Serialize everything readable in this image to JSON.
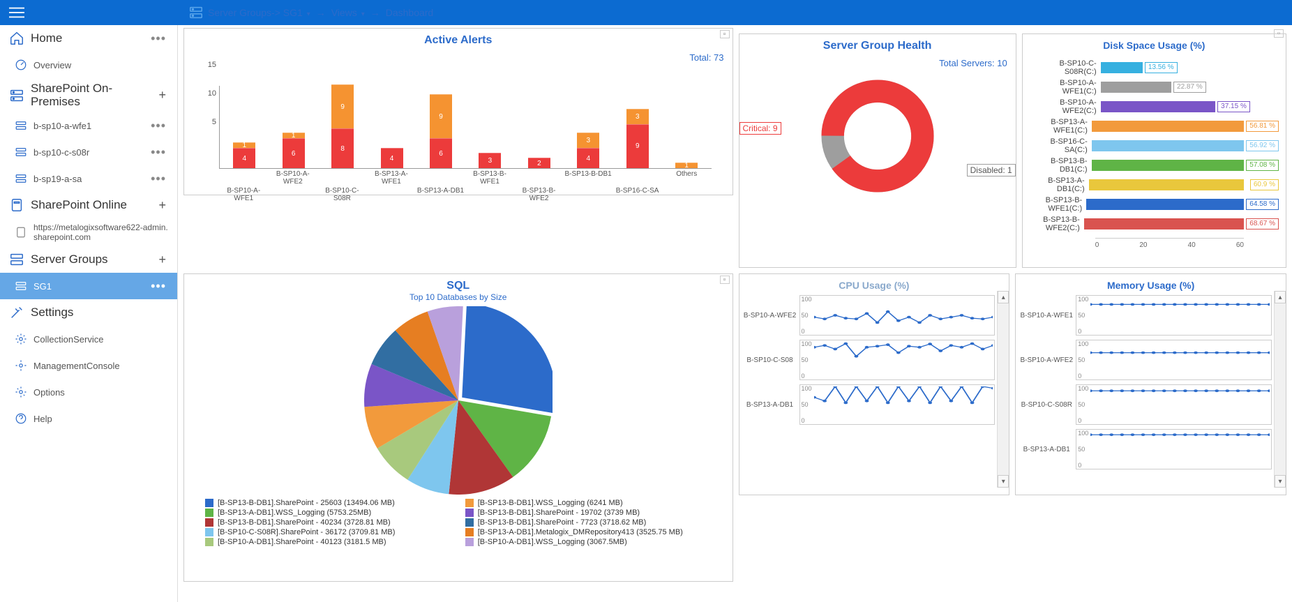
{
  "breadcrumb": {
    "group": "Server Groups-> SG1",
    "views": "Views",
    "dashboard": "Dashboard"
  },
  "sidebar": {
    "home": "Home",
    "overview": "Overview",
    "sp_onprem": "SharePoint On-Premises",
    "onprem_servers": [
      "b-sp10-a-wfe1",
      "b-sp10-c-s08r",
      "b-sp19-a-sa"
    ],
    "sp_online": "SharePoint Online",
    "online_site": "https://metalogixsoftware622-admin.sharepoint.com",
    "server_groups": "Server Groups",
    "sg1": "SG1",
    "settings": "Settings",
    "collection": "CollectionService",
    "mgmt": "ManagementConsole",
    "options": "Options",
    "help": "Help"
  },
  "alerts": {
    "title": "Active Alerts",
    "total_label": "Total: 73",
    "yticks": [
      "15",
      "10",
      "5"
    ],
    "top_labels": [
      "B-SP10-A-WFE2",
      "B-SP13-A-WFE1",
      "B-SP13-B-WFE1",
      "B-SP13-B-DB1"
    ],
    "bottom_labels": [
      "B-SP10-A-WFE1",
      "B-SP10-C-S08R",
      "B-SP13-A-DB1",
      "B-SP13-B-WFE2",
      "B-SP16-C-SA",
      "Others"
    ]
  },
  "health": {
    "title": "Server Group Health",
    "total": "Total Servers: 10",
    "critical": "Critical: 9",
    "disabled": "Disabled: 1"
  },
  "disk": {
    "title": "Disk Space Usage (%)",
    "rows": [
      {
        "lbl": "B-SP10-C-S08R(C:)",
        "pct": 13.56,
        "color": "#36b0e0"
      },
      {
        "lbl": "B-SP10-A-WFE1(C:)",
        "pct": 22.87,
        "color": "#9e9e9e"
      },
      {
        "lbl": "B-SP10-A-WFE2(C:)",
        "pct": 37.15,
        "color": "#7a55c7"
      },
      {
        "lbl": "B-SP13-A-WFE1(C:)",
        "pct": 56.81,
        "color": "#f29a3c"
      },
      {
        "lbl": "B-SP16-C-SA(C:)",
        "pct": 56.92,
        "color": "#7ec6ee"
      },
      {
        "lbl": "B-SP13-B-DB1(C:)",
        "pct": 57.08,
        "color": "#5fb446"
      },
      {
        "lbl": "B-SP13-A-DB1(C:)",
        "pct": 60.9,
        "color": "#e9c73c"
      },
      {
        "lbl": "B-SP13-B-WFE1(C:)",
        "pct": 64.58,
        "color": "#2c6bca"
      },
      {
        "lbl": "B-SP13-B-WFE2(C:)",
        "pct": 68.67,
        "color": "#d9534f"
      }
    ],
    "xticks": [
      "0",
      "20",
      "40",
      "60"
    ]
  },
  "sql": {
    "title": "SQL",
    "subtitle": "Top 10 Databases by Size",
    "legend": [
      {
        "c": "#2c6bca",
        "t": "[B-SP13-B-DB1].SharePoint - 25603 (13494.06 MB)"
      },
      {
        "c": "#5fb446",
        "t": "[B-SP13-A-DB1].WSS_Logging (5753.25MB)"
      },
      {
        "c": "#b03636",
        "t": "[B-SP13-B-DB1].SharePoint - 40234 (3728.81 MB)"
      },
      {
        "c": "#7ec6ee",
        "t": "[B-SP10-C-S08R].SharePoint - 36172 (3709.81 MB)"
      },
      {
        "c": "#a8c97d",
        "t": "[B-SP10-A-DB1].SharePoint - 40123 (3181.5 MB)"
      },
      {
        "c": "#f29a3c",
        "t": "[B-SP13-B-DB1].WSS_Logging (6241 MB)"
      },
      {
        "c": "#7a55c7",
        "t": "[B-SP13-B-DB1].SharePoint - 19702 (3739 MB)"
      },
      {
        "c": "#316ea2",
        "t": "[B-SP13-B-DB1].SharePoint - 7723 (3718.62 MB)"
      },
      {
        "c": "#e67e22",
        "t": "[B-SP13-A-DB1].Metalogix_DMRepository413 (3525.75 MB)"
      },
      {
        "c": "#b9a0dc",
        "t": "[B-SP10-A-DB1].WSS_Logging (3067.5MB)"
      }
    ]
  },
  "cpu": {
    "title": "CPU Usage (%)",
    "servers": [
      "B-SP10-A-WFE2",
      "B-SP10-C-S08",
      "B-SP13-A-DB1"
    ]
  },
  "mem": {
    "title": "Memory Usage (%)",
    "servers": [
      "B-SP10-A-WFE1",
      "B-SP10-A-WFE2",
      "B-SP10-C-S08R",
      "B-SP13-A-DB1"
    ]
  },
  "chart_data": {
    "active_alerts": {
      "type": "bar",
      "stacked": true,
      "categories": [
        "B-SP10-A-WFE1",
        "B-SP10-A-WFE2",
        "B-SP10-C-S08R",
        "B-SP13-A-WFE1",
        "B-SP13-A-DB1",
        "B-SP13-B-WFE1",
        "B-SP13-B-WFE2",
        "B-SP13-B-DB1",
        "B-SP16-C-SA",
        "Others"
      ],
      "series": [
        {
          "name": "red",
          "values": [
            4,
            6,
            8,
            4,
            6,
            3,
            2,
            4,
            9,
            0
          ]
        },
        {
          "name": "orange",
          "values": [
            1,
            1,
            9,
            0,
            9,
            0,
            0,
            3,
            3,
            1
          ]
        }
      ],
      "ylim": [
        0,
        17
      ],
      "total": 73
    },
    "server_group_health": {
      "type": "pie",
      "slices": [
        {
          "label": "Critical",
          "value": 9,
          "color": "#ec3b3b"
        },
        {
          "label": "Disabled",
          "value": 1,
          "color": "#9e9e9e"
        }
      ],
      "total": 10
    },
    "disk_space": {
      "type": "bar",
      "orientation": "horizontal",
      "categories": [
        "B-SP10-C-S08R(C:)",
        "B-SP10-A-WFE1(C:)",
        "B-SP10-A-WFE2(C:)",
        "B-SP13-A-WFE1(C:)",
        "B-SP16-C-SA(C:)",
        "B-SP13-B-DB1(C:)",
        "B-SP13-A-DB1(C:)",
        "B-SP13-B-WFE1(C:)",
        "B-SP13-B-WFE2(C:)"
      ],
      "values": [
        13.56,
        22.87,
        37.15,
        56.81,
        56.92,
        57.08,
        60.9,
        64.58,
        68.67
      ],
      "xlim": [
        0,
        70
      ]
    },
    "sql_top10": {
      "type": "pie",
      "slices": [
        {
          "label": "[B-SP13-B-DB1].SharePoint - 25603",
          "value": 13494.06
        },
        {
          "label": "[B-SP13-B-DB1].WSS_Logging",
          "value": 6241
        },
        {
          "label": "[B-SP13-A-DB1].WSS_Logging",
          "value": 5753.25
        },
        {
          "label": "[B-SP13-B-DB1].SharePoint - 19702",
          "value": 3739
        },
        {
          "label": "[B-SP13-B-DB1].SharePoint - 40234",
          "value": 3728.81
        },
        {
          "label": "[B-SP13-B-DB1].SharePoint - 7723",
          "value": 3718.62
        },
        {
          "label": "[B-SP10-C-S08R].SharePoint - 36172",
          "value": 3709.81
        },
        {
          "label": "[B-SP13-A-DB1].Metalogix_DMRepository413",
          "value": 3525.75
        },
        {
          "label": "[B-SP10-A-DB1].SharePoint - 40123",
          "value": 3181.5
        },
        {
          "label": "[B-SP10-A-DB1].WSS_Logging",
          "value": 3067.5
        }
      ]
    },
    "cpu_usage": {
      "type": "line",
      "ylim": [
        0,
        100
      ],
      "series": [
        {
          "name": "B-SP10-A-WFE2",
          "values": [
            45,
            40,
            50,
            42,
            40,
            55,
            30,
            60,
            35,
            45,
            30,
            50,
            40,
            45,
            50,
            42,
            40,
            45
          ]
        },
        {
          "name": "B-SP10-C-S08",
          "values": [
            85,
            90,
            80,
            95,
            60,
            85,
            88,
            92,
            70,
            88,
            85,
            94,
            75,
            90,
            85,
            95,
            80,
            90
          ]
        },
        {
          "name": "B-SP13-A-DB1",
          "values": [
            70,
            60,
            100,
            55,
            100,
            60,
            100,
            55,
            100,
            60,
            100,
            55,
            100,
            60,
            100,
            55,
            100,
            95
          ]
        }
      ]
    },
    "memory_usage": {
      "type": "line",
      "ylim": [
        0,
        100
      ],
      "series": [
        {
          "name": "B-SP10-A-WFE1",
          "values": [
            80,
            80,
            80,
            80,
            80,
            80,
            80,
            80,
            80,
            80,
            80,
            80,
            80,
            80,
            80,
            80,
            80,
            80
          ]
        },
        {
          "name": "B-SP10-A-WFE2",
          "values": [
            70,
            70,
            70,
            70,
            70,
            70,
            70,
            70,
            70,
            70,
            70,
            70,
            70,
            70,
            70,
            70,
            70,
            70
          ]
        },
        {
          "name": "B-SP10-C-S08R",
          "values": [
            88,
            88,
            88,
            88,
            88,
            88,
            88,
            88,
            88,
            88,
            88,
            88,
            88,
            88,
            88,
            88,
            88,
            88
          ]
        },
        {
          "name": "B-SP13-A-DB1",
          "values": [
            90,
            90,
            90,
            90,
            90,
            90,
            90,
            90,
            90,
            90,
            90,
            90,
            90,
            90,
            90,
            90,
            90,
            90
          ]
        }
      ]
    }
  }
}
